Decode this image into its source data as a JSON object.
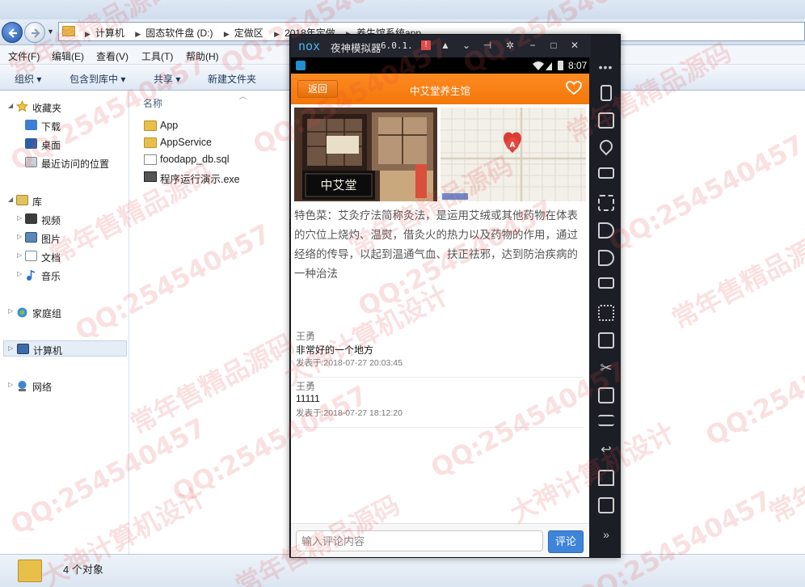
{
  "explorer": {
    "breadcrumb": [
      "计算机",
      "固态软件盘 (D:)",
      "定做区",
      "2018年定做",
      "养生馆系统app"
    ],
    "menu": [
      "文件(F)",
      "编辑(E)",
      "查看(V)",
      "工具(T)",
      "帮助(H)"
    ],
    "commands": [
      "组织 ▾",
      "包含到库中 ▾",
      "共享 ▾",
      "新建文件夹"
    ],
    "nav": {
      "favorites": "收藏夹",
      "favorites_items": [
        "下载",
        "桌面",
        "最近访问的位置"
      ],
      "libraries": "库",
      "library_items": [
        "视频",
        "图片",
        "文档",
        "音乐"
      ],
      "homegroup": "家庭组",
      "computer": "计算机",
      "network": "网络"
    },
    "column_name": "名称",
    "files": [
      "App",
      "AppService",
      "foodapp_db.sql",
      "程序运行演示.exe"
    ],
    "status": "4 个对象"
  },
  "nox": {
    "logo": "nox",
    "title": "夜神模拟器",
    "version": "6.0.1.",
    "alert": "!",
    "clock": "8:07",
    "more": "•••"
  },
  "app": {
    "back": "返回",
    "title": "中艾堂养生馆",
    "photo_sign": "中艾堂",
    "description": "特色菜：艾灸疗法简称灸法，是运用艾绒或其他药物在体表的穴位上烧灼、温熨，借灸火的热力以及药物的作用，通过经络的传导，以起到温通气血、扶正祛邪，达到防治疾病的一种治法",
    "map_marker": "A",
    "comments": [
      {
        "author": "王勇",
        "text": "非常好的一个地方",
        "time": "发表于:2018-07-27 20:03:45"
      },
      {
        "author": "王勇",
        "text": "11111",
        "time": "发表于:2018-07-27 18:12:20"
      }
    ],
    "comment_placeholder": "输入评论内容",
    "comment_button": "评论",
    "accent": "#fd7e14",
    "button_blue": "#3e84d8"
  },
  "watermarks": [
    "常年售精品源码",
    "QQ:254540457",
    "大神计算机设计"
  ]
}
